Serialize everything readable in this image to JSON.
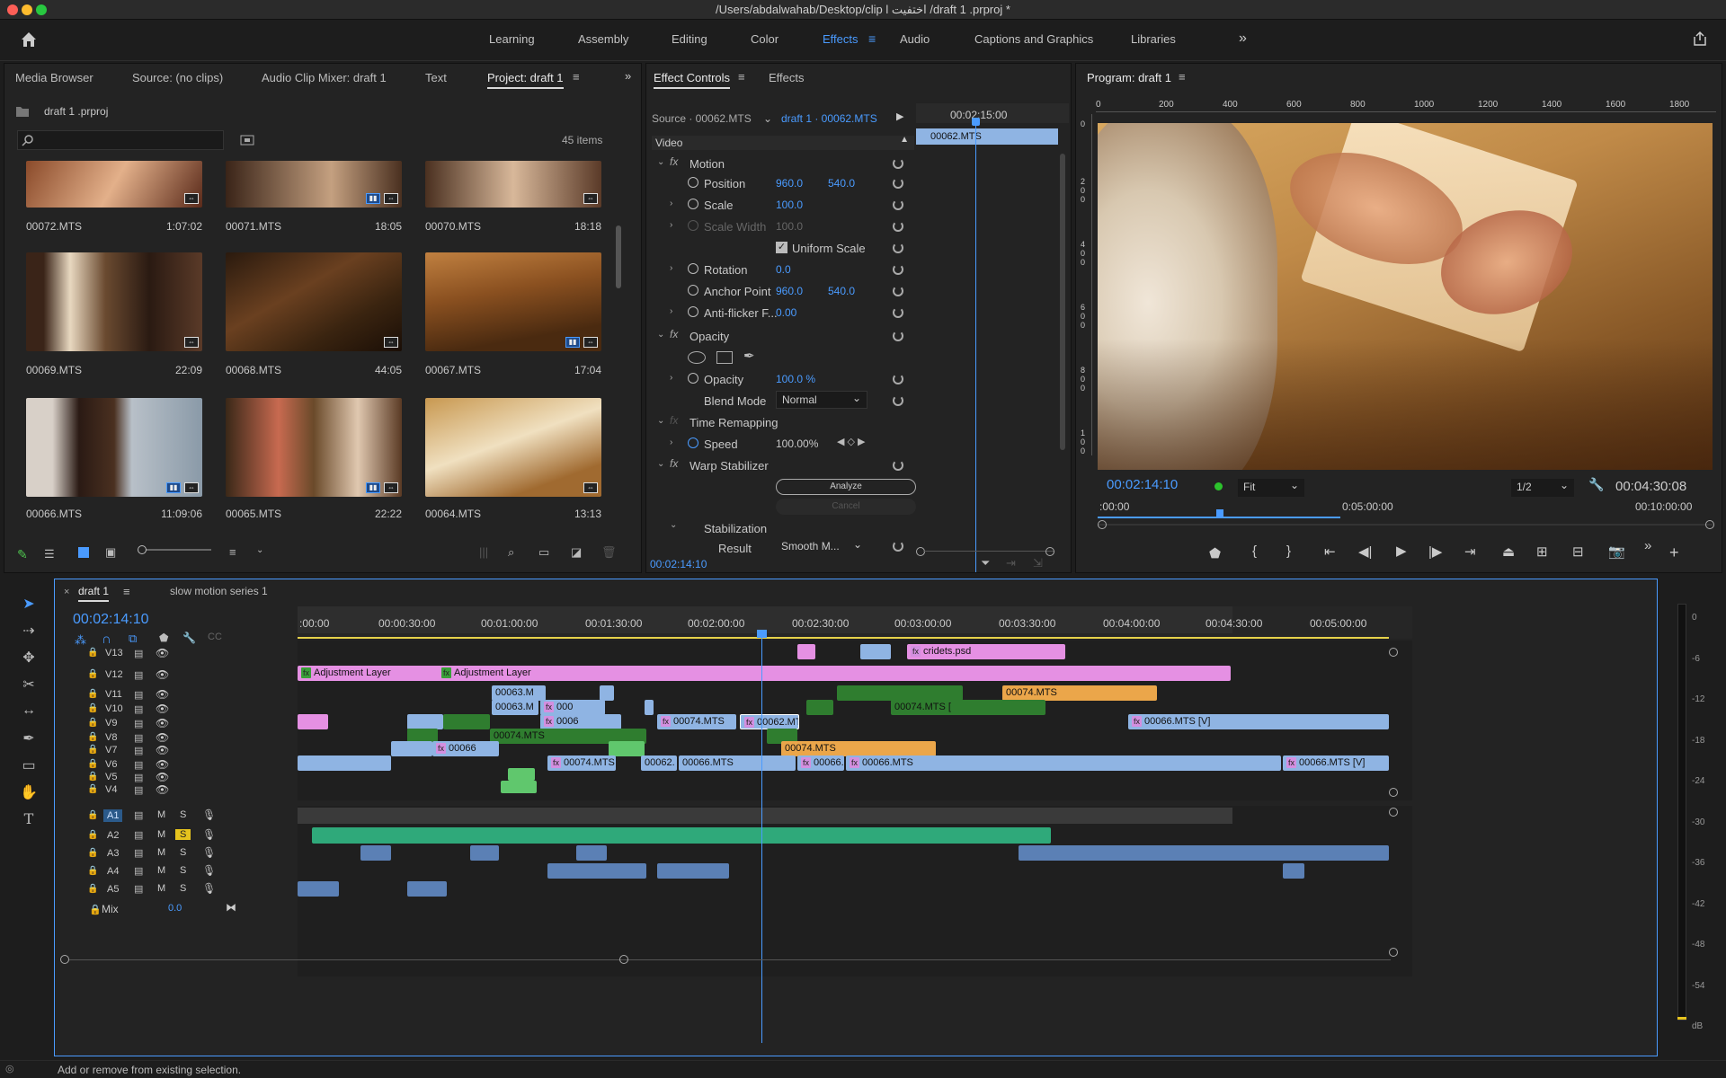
{
  "window": {
    "title": "/Users/abdalwahab/Desktop/clip l اختفيت /draft 1 .prproj *"
  },
  "workspaces": [
    "Learning",
    "Assembly",
    "Editing",
    "Color",
    "Effects",
    "Audio",
    "Captions and Graphics",
    "Libraries"
  ],
  "active_workspace": "Effects",
  "project_panel": {
    "tabs": [
      "Media Browser",
      "Source: (no clips)",
      "Audio Clip Mixer: draft 1",
      "Text",
      "Project: draft 1"
    ],
    "file": "draft 1 .prproj",
    "items_count": "45 items",
    "clips": [
      {
        "name": "00072.MTS",
        "dur": "1:07:02"
      },
      {
        "name": "00071.MTS",
        "dur": "18:05"
      },
      {
        "name": "00070.MTS",
        "dur": "18:18"
      },
      {
        "name": "00069.MTS",
        "dur": "22:09"
      },
      {
        "name": "00068.MTS",
        "dur": "44:05"
      },
      {
        "name": "00067.MTS",
        "dur": "17:04"
      },
      {
        "name": "00066.MTS",
        "dur": "11:09:06"
      },
      {
        "name": "00065.MTS",
        "dur": "22:22"
      },
      {
        "name": "00064.MTS",
        "dur": "13:13"
      }
    ]
  },
  "effect_controls": {
    "tabs": [
      "Effect Controls",
      "Effects"
    ],
    "source": "Source · 00062.MTS",
    "target": "draft 1 · 00062.MTS",
    "ruler_time": "00:02:15:00",
    "clip": "00062.MTS",
    "section": "Video",
    "motion": "Motion",
    "position_label": "Position",
    "position_x": "960.0",
    "position_y": "540.0",
    "scale_label": "Scale",
    "scale": "100.0",
    "scale_width_label": "Scale Width",
    "scale_width": "100.0",
    "uniform_scale": "Uniform Scale",
    "rotation_label": "Rotation",
    "rotation": "0.0",
    "anchor_label": "Anchor Point",
    "anchor_x": "960.0",
    "anchor_y": "540.0",
    "antiflicker_label": "Anti-flicker F...",
    "antiflicker": "0.00",
    "opacity_section": "Opacity",
    "opacity_label": "Opacity",
    "opacity": "100.0 %",
    "blend_label": "Blend Mode",
    "blend": "Normal",
    "time_remap": "Time Remapping",
    "speed_label": "Speed",
    "speed": "100.00%",
    "warp": "Warp Stabilizer",
    "analyze": "Analyze",
    "cancel": "Cancel",
    "stabilization": "Stabilization",
    "result_label": "Result",
    "result": "Smooth M...",
    "timecode": "00:02:14:10"
  },
  "program": {
    "title": "Program: draft 1",
    "ruler": [
      "0",
      "200",
      "400",
      "600",
      "800",
      "1000",
      "1200",
      "1400",
      "1600",
      "1800"
    ],
    "vruler": [
      "0",
      "2 0 0",
      "4 0 0",
      "6 0 0",
      "8 0 0",
      "1 0 0"
    ],
    "timecode": "00:02:14:10",
    "fit": "Fit",
    "res": "1/2",
    "duration": "00:04:30:08",
    "mini_ruler": [
      ":00:00",
      "0:05:00:00",
      "00:10:00:00"
    ]
  },
  "timeline": {
    "tabs": [
      "draft 1",
      "slow motion series 1"
    ],
    "timecode": "00:02:14:10",
    "ruler": [
      ":00:00",
      "00:00:30:00",
      "00:01:00:00",
      "00:01:30:00",
      "00:02:00:00",
      "00:02:30:00",
      "00:03:00:00",
      "00:03:30:00",
      "00:04:00:00",
      "00:04:30:00",
      "00:05:00:00"
    ],
    "video_tracks": [
      "V13",
      "V12",
      "V11",
      "V10",
      "V9",
      "V8",
      "V7",
      "V6",
      "V5",
      "V4"
    ],
    "audio_tracks": [
      "A1",
      "A2",
      "A3",
      "A4",
      "A5"
    ],
    "mix_label": "Mix",
    "mix_value": "0.0",
    "audio_btn_m": "M",
    "audio_btn_s": "S",
    "clip_labels": {
      "cridets": "cridets.psd",
      "adj": "Adjustment Layer",
      "c63a": "00063.M",
      "c63b": "00063.M",
      "c0006": "0006",
      "c000": "000",
      "c74a": "00074.MTS",
      "c74b": "00074.MTS [",
      "c62a": "00062.MT",
      "c74c": "00074.MTS",
      "c74d": "00074.MTS",
      "c66a": "00066.MTS [V]",
      "c74e": "00074.MTS",
      "c66b": "00066",
      "c74f": "00074.MTS",
      "c74g": "00074.MTS [",
      "c62b": "00062.",
      "c66c": "00066.MTS",
      "c66d": "00066.",
      "c66e": "00066.MTS",
      "c66f": "00066.MTS [V]"
    }
  },
  "vu": [
    "0",
    "-6",
    "-12",
    "-18",
    "-24",
    "-30",
    "-36",
    "-42",
    "-48",
    "-54",
    "dB"
  ],
  "status": "Add or remove from existing selection.",
  "colors": {
    "accent": "#4a9bff",
    "video_pink": "#e590e3",
    "video_blue": "#8fb4e3",
    "video_green": "#2f7d2f",
    "orange": "#eba64a",
    "audio_green": "#2fa97a"
  }
}
